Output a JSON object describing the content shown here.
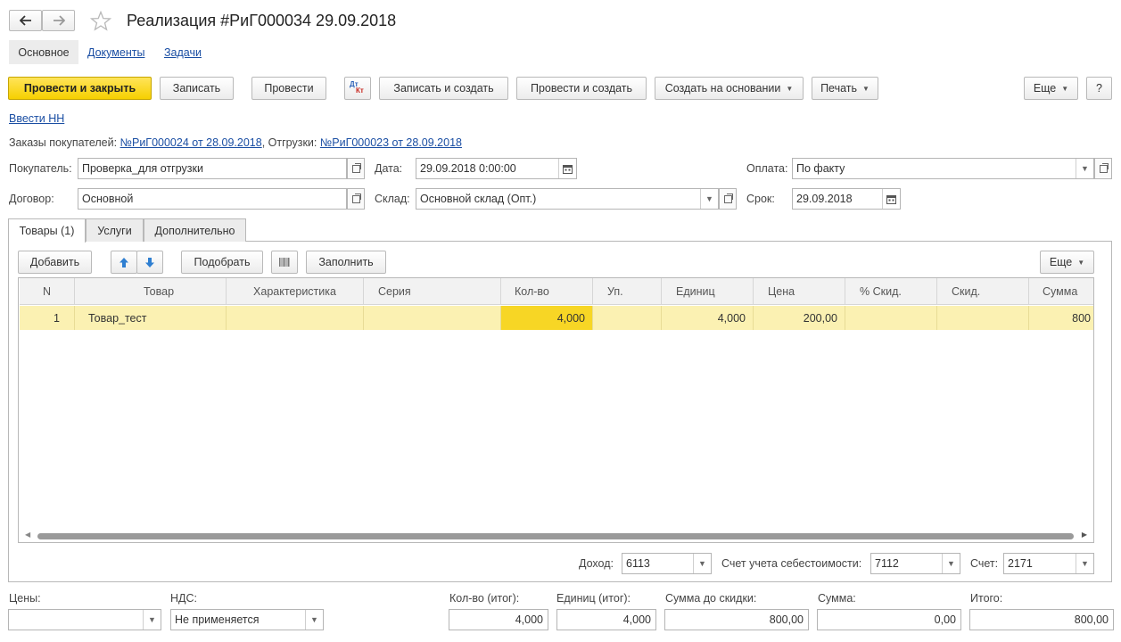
{
  "window": {
    "title": "Реализация #РиГ000034 29.09.2018"
  },
  "nav_tabs": [
    "Основное",
    "Документы",
    "Задачи"
  ],
  "toolbar": {
    "post_close": "Провести и закрыть",
    "save": "Записать",
    "post": "Провести",
    "dtkt_dt": "Дт",
    "dtkt_kt": "Кт",
    "save_create": "Записать и создать",
    "post_create": "Провести и создать",
    "create_based": "Создать на основании",
    "print": "Печать",
    "more": "Еще",
    "help": "?"
  },
  "enter_nn": "Ввести НН",
  "orders": {
    "orders_label": "Заказы покупателей:",
    "orders_link": "№РиГ000024 от 28.09.2018",
    "shipments_label": ", Отгрузки:",
    "shipments_link": "№РиГ000023 от 28.09.2018"
  },
  "form": {
    "buyer_label": "Покупатель:",
    "buyer_value": "Проверка_для отгрузки",
    "contract_label": "Договор:",
    "contract_value": "Основной",
    "date_label": "Дата:",
    "date_value": "29.09.2018  0:00:00",
    "warehouse_label": "Склад:",
    "warehouse_value": "Основной склад (Опт.)",
    "payment_label": "Оплата:",
    "payment_value": "По факту",
    "term_label": "Срок:",
    "term_value": "29.09.2018"
  },
  "content_tabs": [
    "Товары (1)",
    "Услуги",
    "Дополнительно"
  ],
  "grid_toolbar": {
    "add": "Добавить",
    "select": "Подобрать",
    "fill": "Заполнить",
    "more": "Еще"
  },
  "grid": {
    "columns": [
      "N",
      "Товар",
      "Характеристика",
      "Серия",
      "Кол-во",
      "Уп.",
      "Единиц",
      "Цена",
      "% Скид.",
      "Скид.",
      "Сумма"
    ],
    "rows": [
      [
        "1",
        "Товар_тест",
        "",
        "",
        "4,000",
        "",
        "4,000",
        "200,00",
        "",
        "",
        "800"
      ]
    ]
  },
  "accounts": {
    "income_label": "Доход:",
    "income_value": "6113",
    "cost_label": "Счет учета себестоимости:",
    "cost_value": "7112",
    "account_label": "Счет:",
    "account_value": "2171"
  },
  "footer": {
    "prices_label": "Цены:",
    "prices_value": "",
    "vat_label": "НДС:",
    "vat_value": "Не применяется",
    "qty_total_label": "Кол-во (итог):",
    "qty_total_value": "4,000",
    "units_total_label": "Единиц (итог):",
    "units_total_value": "4,000",
    "sum_before_label": "Сумма до скидки:",
    "sum_before_value": "800,00",
    "sum_label": "Сумма:",
    "sum_value": "0,00",
    "total_label": "Итого:",
    "total_value": "800,00"
  },
  "colors": {
    "primary_button": "#f6d000",
    "selected_row": "#fbf1b2",
    "active_cell": "#f7d625",
    "link": "#1a4ea3"
  }
}
